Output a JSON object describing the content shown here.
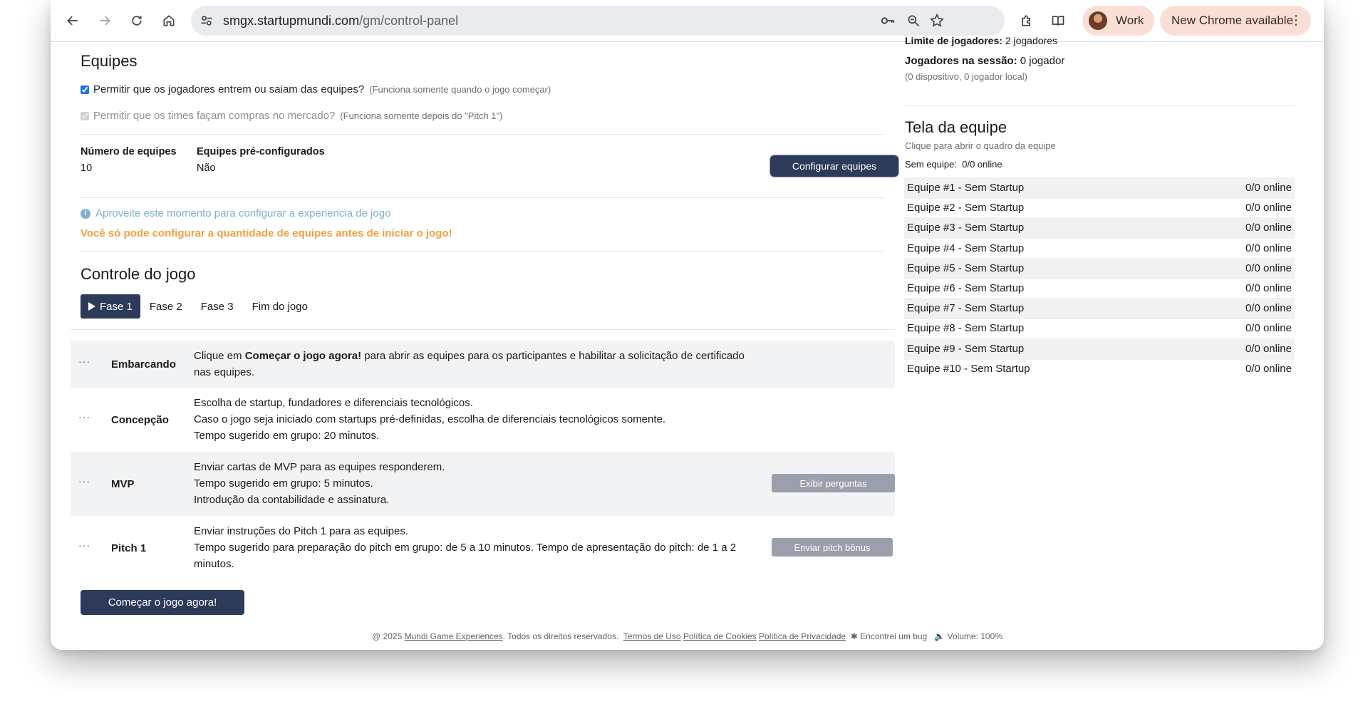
{
  "browser": {
    "url_host": "smgx.startupmundi.com",
    "url_path": "/gm/control-panel",
    "profile_label": "Work",
    "update_label": "New Chrome available"
  },
  "teams_section": {
    "title": "Equipes",
    "allow_join_label": "Permitir que os jogadores entrem ou saiam das equipes?",
    "allow_join_note": "(Funciona somente quando o jogo começar)",
    "allow_join_checked": true,
    "allow_market_label": "Permitir que os times façam compras no mercado?",
    "allow_market_note": "(Funciona somente depois do \"Pitch 1\")",
    "allow_market_checked": true,
    "num_teams_label": "Número de equipes",
    "num_teams_value": "10",
    "preconfigured_label": "Equipes pré-configurados",
    "preconfigured_value": "Não",
    "configure_button": "Configurar equipes",
    "info_icon": "info-icon",
    "info_text": "Aproveite este momento para configurar a experiencia de jogo",
    "warning_text": "Você só pode configurar a quantidade de equipes antes de iniciar o jogo!"
  },
  "game_control": {
    "title": "Controle do jogo",
    "tabs": [
      {
        "label": "Fase 1",
        "active": true
      },
      {
        "label": "Fase 2",
        "active": false
      },
      {
        "label": "Fase 3",
        "active": false
      },
      {
        "label": "Fim do jogo",
        "active": false
      }
    ],
    "phases": [
      {
        "name": "Embarcando",
        "desc_pre": "Clique em ",
        "desc_bold": "Começar o jogo agora!",
        "desc_post": " para abrir as equipes para os participantes e habilitar a solicitação de certificado nas equipes."
      },
      {
        "name": "Concepção",
        "lines": [
          "Escolha de startup, fundadores e diferenciais tecnológicos.",
          "Caso o jogo seja iniciado com startups pré-definidas, escolha de diferenciais tecnológicos somente.",
          "Tempo sugerido em grupo: 20 minutos."
        ]
      },
      {
        "name": "MVP",
        "lines": [
          "Enviar cartas de MVP para as equipes responderem.",
          "Tempo sugerido em grupo: 5 minutos.",
          "Introdução da contabilidade e assinatura."
        ],
        "button": "Exibir perguntas"
      },
      {
        "name": "Pitch 1",
        "lines": [
          "Enviar instruções do Pitch 1 para as equipes.",
          "Tempo sugerido para preparação do pitch em grupo: de 5 a 10 minutos. Tempo de apresentação do pitch: de 1 a 2 minutos."
        ],
        "button": "Enviar pitch bônus"
      }
    ],
    "start_button": "Começar o jogo agora!"
  },
  "session": {
    "player_limit_label": "Limite de jogadores:",
    "player_limit_value": "2 jogadores",
    "players_in_session_label": "Jogadores na sessão:",
    "players_in_session_value": "0 jogador",
    "players_detail": "(0 dispositivo, 0 jogador local)"
  },
  "team_screen": {
    "title": "Tela da equipe",
    "subtitle": "Clique para abrir o quadro da equipe",
    "no_team_label": "Sem equipe:",
    "no_team_value": "0/0 online",
    "teams": [
      {
        "name": "Equipe #1 - Sem Startup",
        "status": "0/0 online"
      },
      {
        "name": "Equipe #2 - Sem Startup",
        "status": "0/0 online"
      },
      {
        "name": "Equipe #3 - Sem Startup",
        "status": "0/0 online"
      },
      {
        "name": "Equipe #4 - Sem Startup",
        "status": "0/0 online"
      },
      {
        "name": "Equipe #5 - Sem Startup",
        "status": "0/0 online"
      },
      {
        "name": "Equipe #6 - Sem Startup",
        "status": "0/0 online"
      },
      {
        "name": "Equipe #7 - Sem Startup",
        "status": "0/0 online"
      },
      {
        "name": "Equipe #8 - Sem Startup",
        "status": "0/0 online"
      },
      {
        "name": "Equipe #9 - Sem Startup",
        "status": "0/0 online"
      },
      {
        "name": "Equipe #10 - Sem Startup",
        "status": "0/0 online"
      }
    ]
  },
  "footer": {
    "copyright": "@ 2025",
    "company_link": "Mundi Game Experiences",
    "rights": ". Todos os direitos reservados.",
    "terms_link": "Termos de Uso",
    "cookies_link": "Política de Cookies",
    "privacy_link": "Política de Privacidade",
    "bug_label": "Encontrei um bug",
    "volume_label": "Volume: 100%"
  }
}
